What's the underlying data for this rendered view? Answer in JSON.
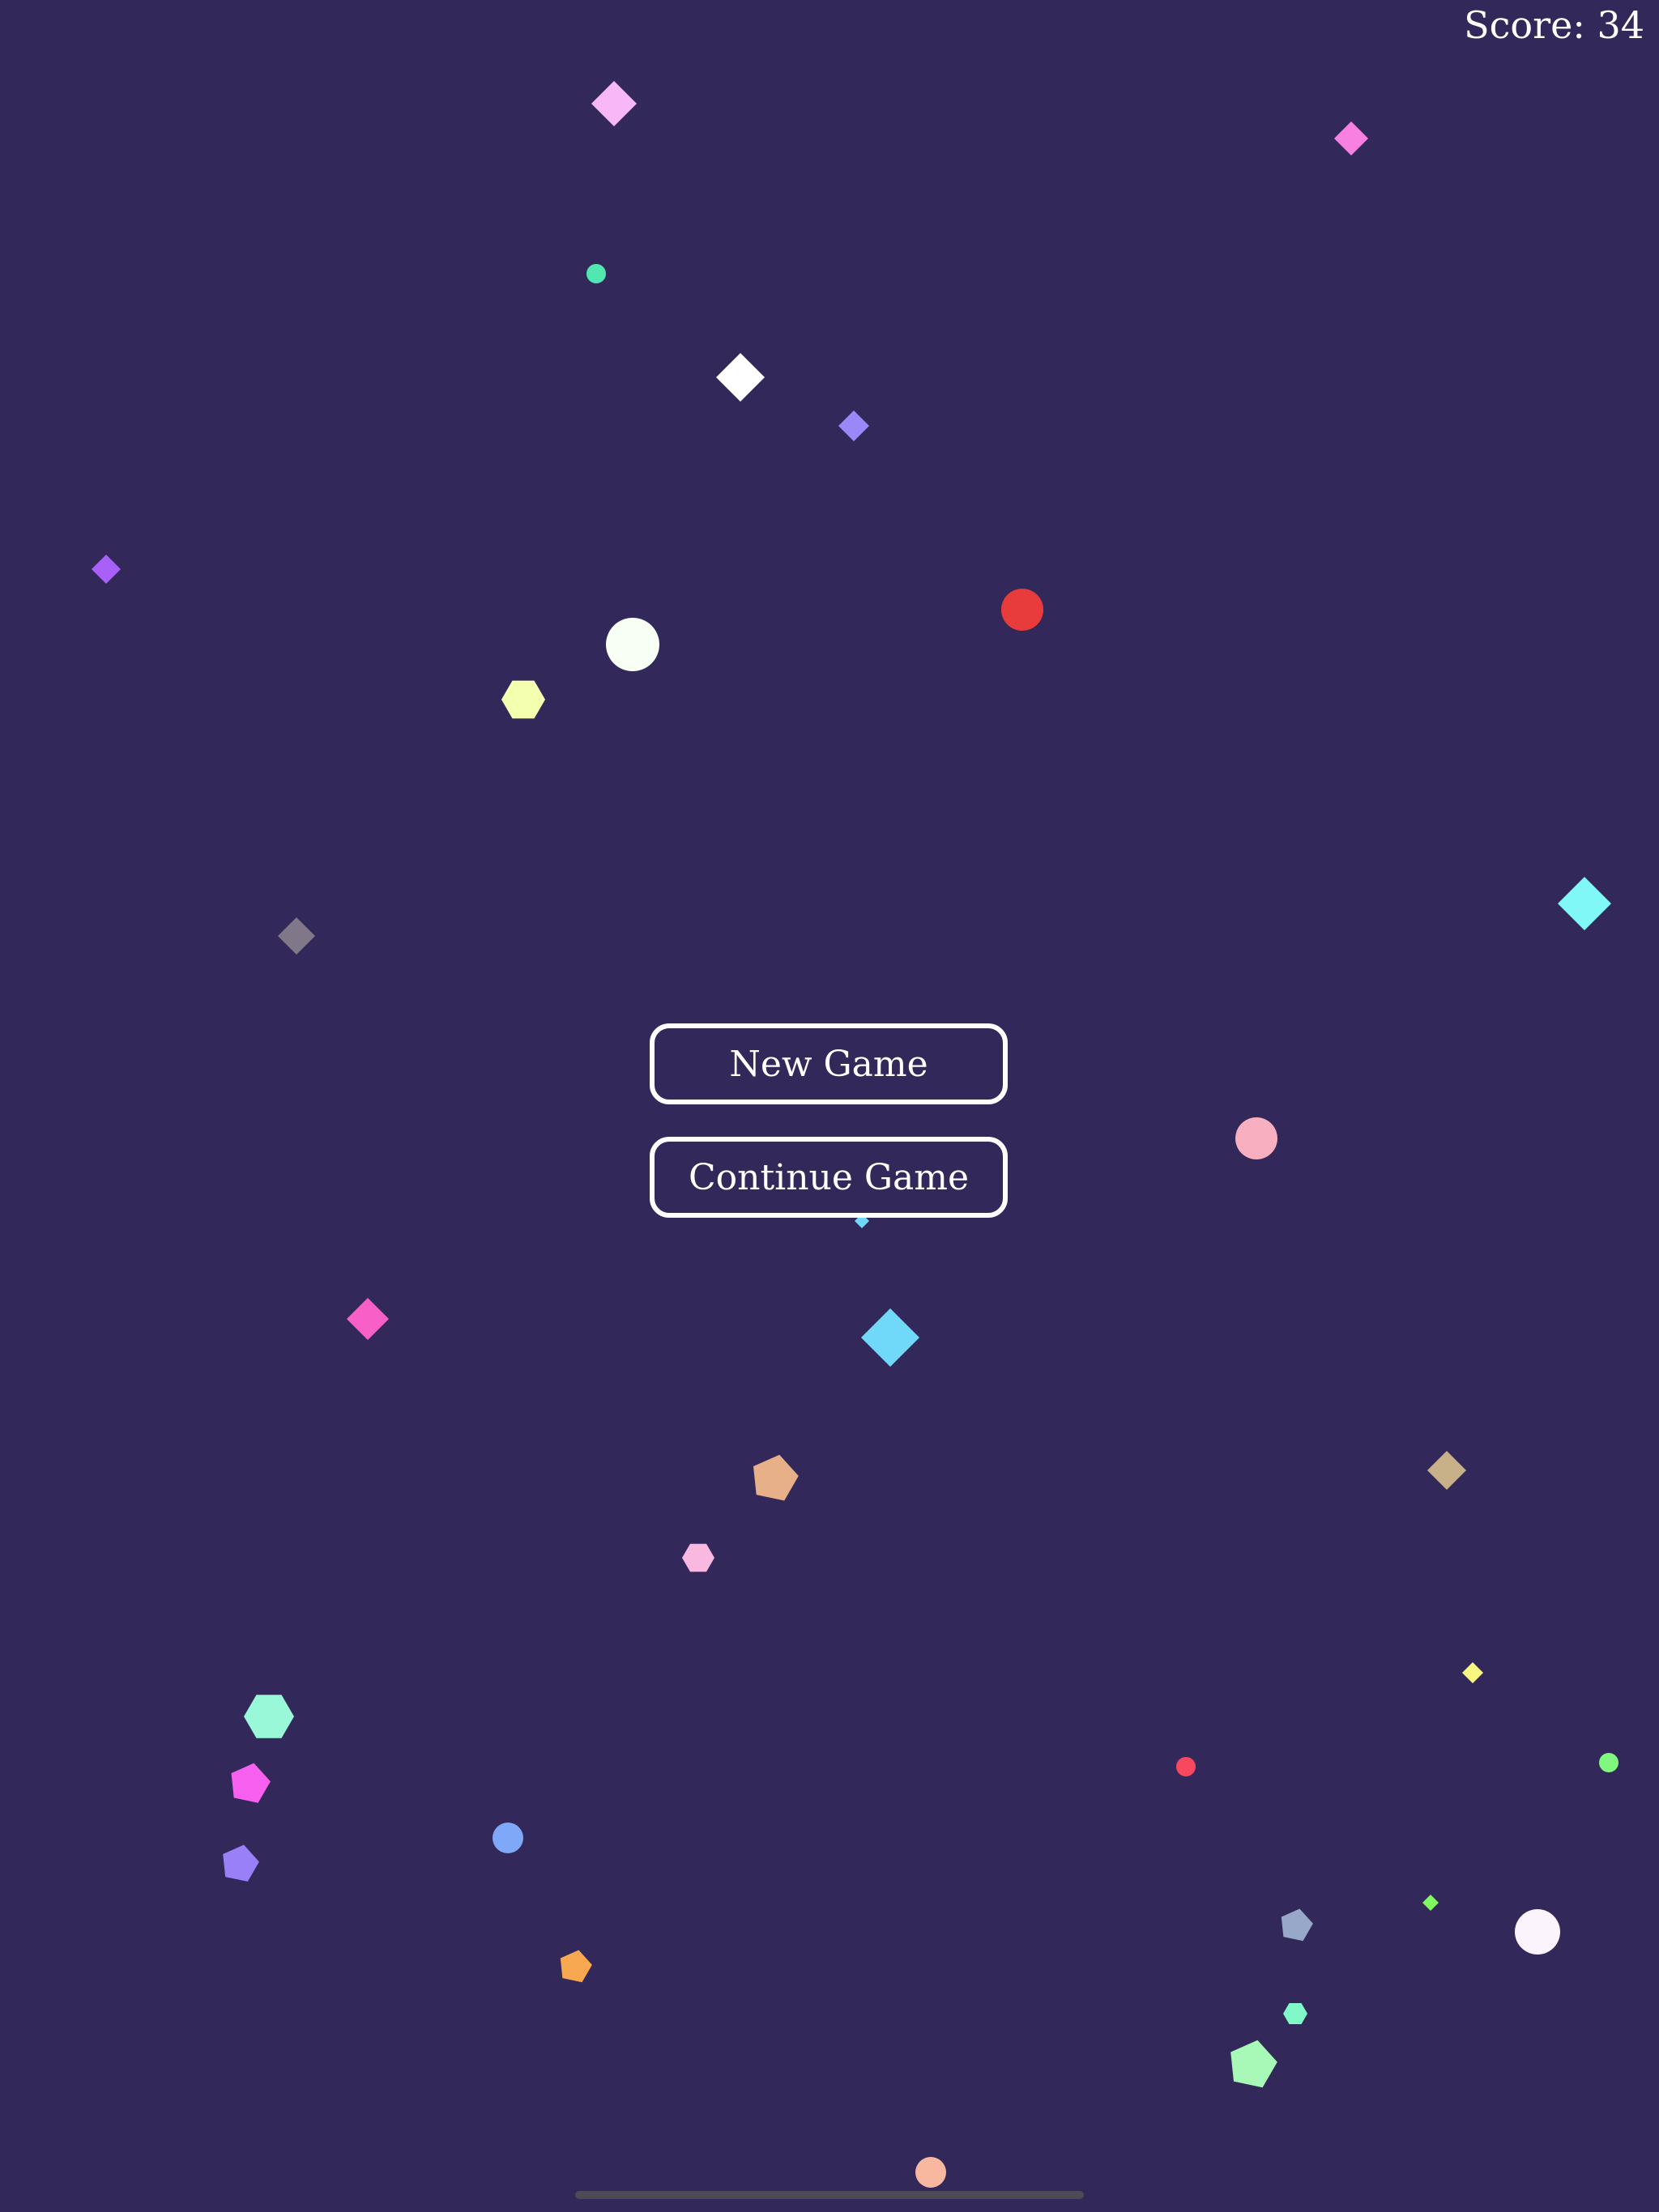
{
  "hud": {
    "score_text": "Score: 34"
  },
  "menu": {
    "new_game_label": "New Game",
    "continue_game_label": "Continue Game"
  },
  "colors": {
    "background": "#33285a",
    "button_border": "#ffffff",
    "text": "#ffffff"
  },
  "shape_types": [
    "diamond",
    "circle",
    "hexagon",
    "pentagon"
  ]
}
